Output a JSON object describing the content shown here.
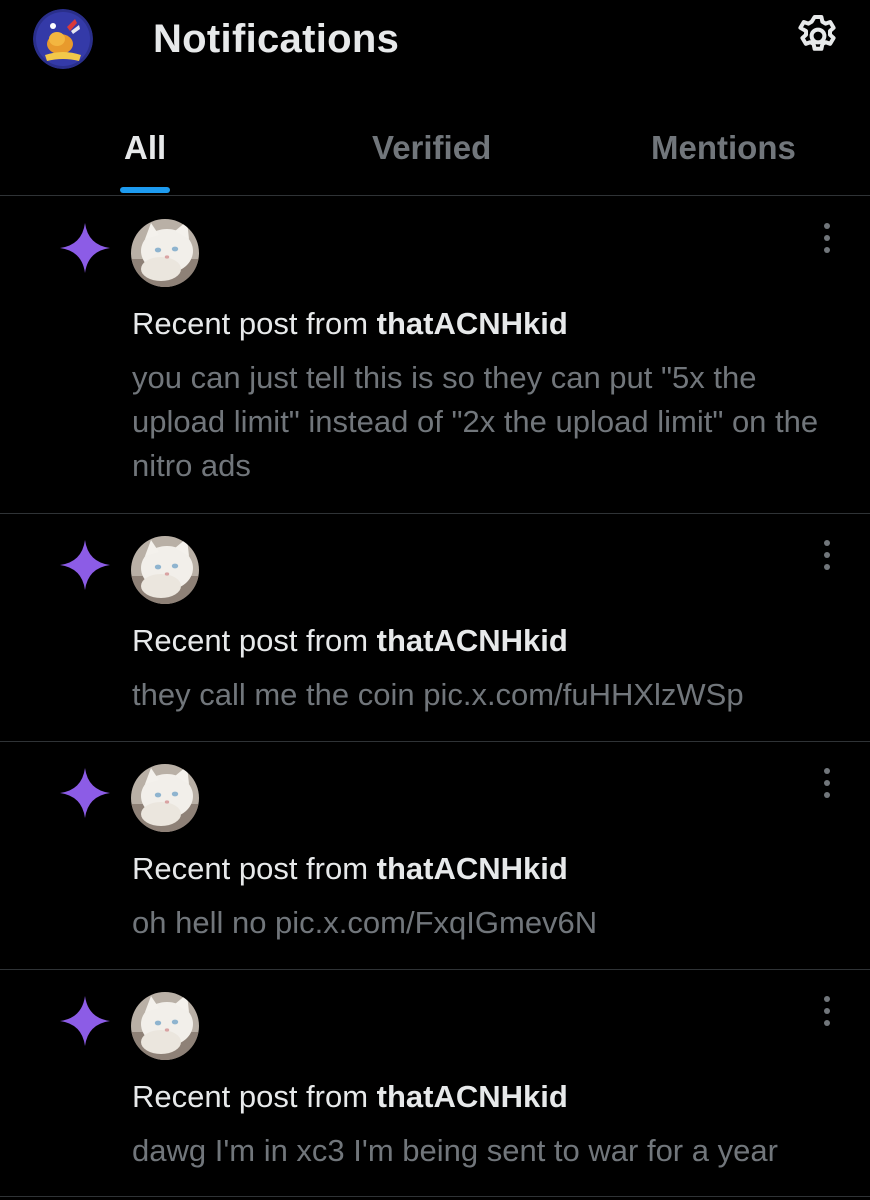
{
  "header": {
    "title": "Notifications",
    "avatar_icon": "profile-avatar",
    "settings_icon": "gear-icon"
  },
  "tabs": [
    {
      "label": "All",
      "active": true
    },
    {
      "label": "Verified",
      "active": false
    },
    {
      "label": "Mentions",
      "active": false
    }
  ],
  "notifications": [
    {
      "prefix": "Recent post from ",
      "user": "thatACNHkid",
      "text": "you can just tell this is so they can put \"5x the upload limit\" instead of \"2x the upload limit\" on the nitro ads"
    },
    {
      "prefix": "Recent post from ",
      "user": "thatACNHkid",
      "text": "they call me the coin pic.x.com/fuHHXlzWSp"
    },
    {
      "prefix": "Recent post from ",
      "user": "thatACNHkid",
      "text": "oh hell no pic.x.com/FxqIGmev6N"
    },
    {
      "prefix": "Recent post from ",
      "user": "thatACNHkid",
      "text": "dawg I'm in xc3 I'm being sent to war for a year"
    }
  ],
  "colors": {
    "background": "#000000",
    "primary_text": "#e7e9ea",
    "secondary_text": "#71767b",
    "accent_blue": "#1d9bf0",
    "sparkle_purple": "#8c5ce6",
    "divider": "#2f3336"
  }
}
